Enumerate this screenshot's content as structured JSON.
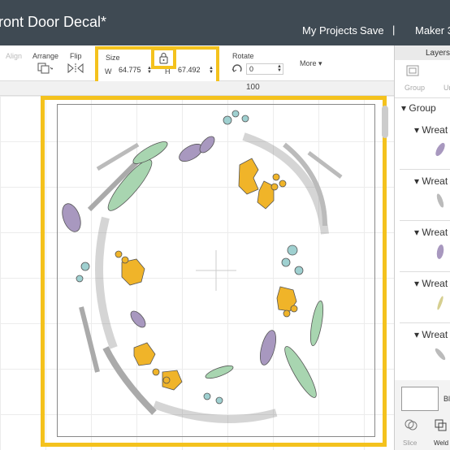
{
  "header": {
    "title": "ront Door Decal*",
    "my_projects": "My Projects",
    "save": "Save",
    "separator": "|",
    "machine": "Maker 3"
  },
  "toolbar": {
    "align": "Align",
    "arrange": "Arrange",
    "flip": "Flip",
    "size": "Size",
    "w_label": "W",
    "w_value": "64.775",
    "h_label": "H",
    "h_value": "67.492",
    "rotate": "Rotate",
    "rotate_value": "0",
    "more": "More"
  },
  "ruler": {
    "mark": "100"
  },
  "layers_panel": {
    "tab": "Layers",
    "group_tab": "Group",
    "ungroup_tab": "Un",
    "group_label": "Group",
    "items": [
      {
        "label": "Wreat",
        "thumb_color": "#9b86ad"
      },
      {
        "label": "Wreat",
        "thumb_color": "#a9a9a9"
      },
      {
        "label": "Wreat",
        "thumb_color": "#9b86ad"
      },
      {
        "label": "Wreat",
        "thumb_color": "#c9c47a"
      },
      {
        "label": "Wreat",
        "thumb_color": "#a9a9a9"
      }
    ],
    "blank_label": "Bl",
    "slice": "Slice",
    "weld": "Weld"
  },
  "colors": {
    "header_bg": "#3f4a53",
    "highlight": "#f4c21d",
    "leaf_green": "#a8d5b0",
    "leaf_purple": "#a898bf",
    "leaf_gray": "#c8c8c8",
    "holly_gold": "#f0b429",
    "leaf_teal": "#9fd0d0"
  },
  "icons": {
    "lock": "lock-icon",
    "arrange": "arrange-icon",
    "flip": "flip-icon",
    "rotate": "rotate-icon",
    "group": "group-icon"
  }
}
